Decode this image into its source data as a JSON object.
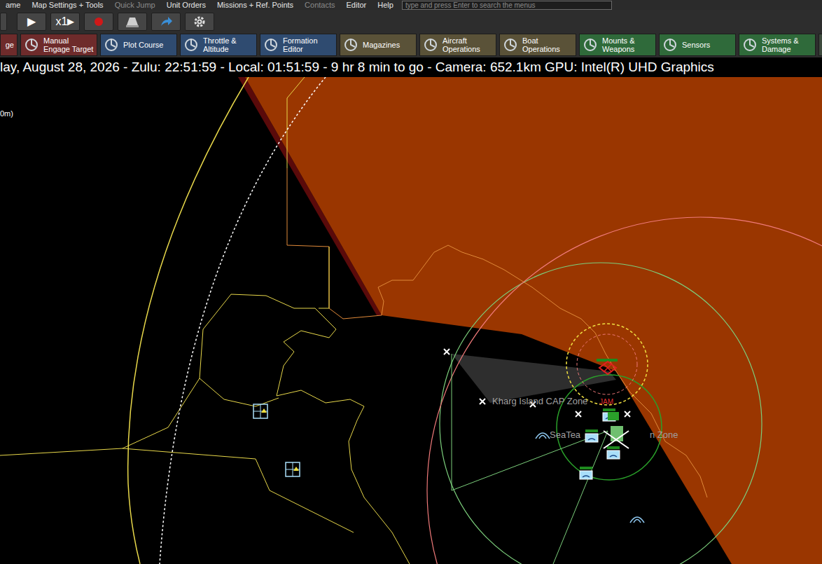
{
  "menu": [
    {
      "label": "ame",
      "disabled": false
    },
    {
      "label": "Map Settings + Tools",
      "disabled": false
    },
    {
      "label": "Quick Jump",
      "disabled": true
    },
    {
      "label": "Unit Orders",
      "disabled": false
    },
    {
      "label": "Missions + Ref. Points",
      "disabled": false
    },
    {
      "label": "Contacts",
      "disabled": true
    },
    {
      "label": "Editor",
      "disabled": false
    },
    {
      "label": "Help",
      "disabled": false
    }
  ],
  "search": {
    "placeholder": "type and press Enter to search the menus"
  },
  "toolbar": {
    "play": "▶",
    "speed": "x1",
    "speed_arrow": "▶"
  },
  "ribbon": [
    {
      "lines": [
        "ge"
      ],
      "color": "#6e2b2b"
    },
    {
      "lines": [
        "Manual",
        "Engage Target"
      ],
      "color": "#6e2b2b"
    },
    {
      "lines": [
        "Plot Course"
      ],
      "color": "#2f4b70"
    },
    {
      "lines": [
        "Throttle &",
        "Altitude"
      ],
      "color": "#2f4b70"
    },
    {
      "lines": [
        "Formation",
        "Editor"
      ],
      "color": "#2f4b70"
    },
    {
      "lines": [
        "Magazines"
      ],
      "color": "#5a5238"
    },
    {
      "lines": [
        "Aircraft",
        "Operations"
      ],
      "color": "#5a5238"
    },
    {
      "lines": [
        "Boat",
        "Operations"
      ],
      "color": "#5a5238"
    },
    {
      "lines": [
        "Mounts &",
        "Weapons"
      ],
      "color": "#2f6a3a"
    },
    {
      "lines": [
        "Sensors"
      ],
      "color": "#2f6a3a"
    },
    {
      "lines": [
        "Systems &",
        "Damage"
      ],
      "color": "#2f6a3a"
    },
    {
      "lines": [],
      "color": "#3d4a3d"
    }
  ],
  "status_line": "lay, August 28, 2026 - Zulu: 22:51:59 - Local: 01:51:59 - 9 hr 8 min to go - Camera: 652.1km GPU: Intel(R) UHD Graphics",
  "map": {
    "scale_label": "0m)",
    "labels": [
      {
        "text": "Kharg Island CAP Zone",
        "color": "#a0a0a0"
      },
      {
        "text": "JAM",
        "color": "#e03030"
      },
      {
        "text": "SeaTea",
        "color": "#a0a0a0"
      },
      {
        "text": "n Zone",
        "color": "#a0a0a0"
      }
    ]
  }
}
